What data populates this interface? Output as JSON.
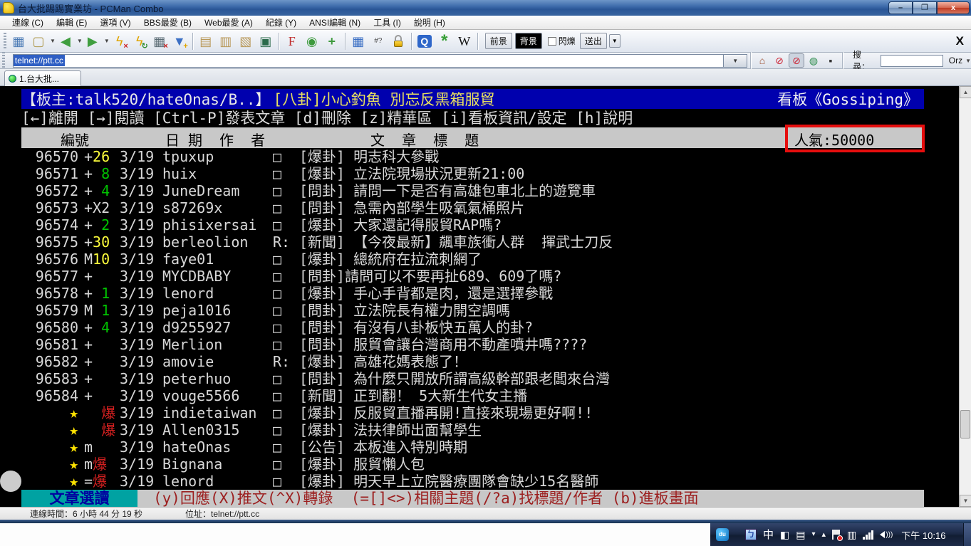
{
  "window": {
    "title": "台大批踢踢實業坊 - PCMan Combo",
    "minimize": "–",
    "restore": "❐",
    "close": "x"
  },
  "menu": {
    "items": [
      "連線 (C)",
      "編輯 (E)",
      "選項 (V)",
      "BBS最愛 (B)",
      "Web最愛 (A)",
      "紀錄 (Y)",
      "ANSI編輯 (N)",
      "工具 (I)",
      "說明 (H)"
    ]
  },
  "toolbar": {
    "buttons": [
      "session-icon",
      "new-tab-icon",
      "back-icon",
      "forward-icon",
      "disconnect-icon",
      "reconnect-icon",
      "close-session-icon",
      "add-bookmark-icon",
      "|",
      "copy-icon",
      "copy-ansi-icon",
      "paste-icon",
      "preview-icon",
      "|",
      "font-icon",
      "settings-gear-icon",
      "resize-window-icon",
      "|",
      "fullscreen-icon",
      "encoding-icon",
      "unlock-icon",
      "|",
      "quick-launch-icon",
      "services-icon",
      "wikipedia-icon"
    ],
    "ansi": {
      "foreground": "前景",
      "background": "背景",
      "blink": "閃爍",
      "send": "送出"
    },
    "close_glyph": "X"
  },
  "addressbar": {
    "url": "telnet://ptt.cc",
    "buttons": [
      "home-icon",
      "hide-sidebar-icon",
      "show-sidebar-icon",
      "globe-icon",
      "new-window-icon"
    ],
    "search_label": "搜尋：",
    "search_value": "",
    "search_engine": "Orz"
  },
  "tabs": [
    {
      "label": "1.台大批..."
    }
  ],
  "terminal": {
    "title_line": {
      "moderators": "【板主:talk520/hateOnas/B..】",
      "topic": "[八卦]小心釣魚 別忘反黑箱服貿",
      "board": "看板《Gossiping》"
    },
    "help_line": "[←]離開 [→]閱讀 [Ctrl-P]發表文章 [d]刪除 [z]精華區 [i]看板資訊/設定 [h]說明",
    "header": {
      "num": "編號",
      "date": "日 期",
      "author": "作  者",
      "title": "文  章  標  題",
      "popularity": "人氣:50000"
    },
    "rows": [
      {
        "num": "96570",
        "push": [
          {
            "t": "+",
            "c": "w"
          },
          {
            "t": "26",
            "c": "y"
          }
        ],
        "date": "3/19",
        "author": "tpuxup",
        "mark": "□",
        "title": "[爆卦] 明志科大參戰"
      },
      {
        "num": "96571",
        "push": [
          {
            "t": "+ ",
            "c": "w"
          },
          {
            "t": "8",
            "c": "g"
          }
        ],
        "date": "3/19",
        "author": "huix",
        "mark": "□",
        "title": "[爆卦] 立法院現場狀況更新21:00"
      },
      {
        "num": "96572",
        "push": [
          {
            "t": "+ ",
            "c": "w"
          },
          {
            "t": "4",
            "c": "g"
          }
        ],
        "date": "3/19",
        "author": "JuneDream",
        "mark": "□",
        "title": "[問卦] 請問一下是否有高雄包車北上的遊覽車"
      },
      {
        "num": "96573",
        "push": [
          {
            "t": "+X2",
            "c": "w"
          }
        ],
        "date": "3/19",
        "author": "s87269x",
        "mark": "□",
        "title": "[問卦] 急需內部學生吸氧氣桶照片"
      },
      {
        "num": "96574",
        "push": [
          {
            "t": "+ ",
            "c": "w"
          },
          {
            "t": "2",
            "c": "g"
          }
        ],
        "date": "3/19",
        "author": "phisixersai",
        "mark": "□",
        "title": "[爆卦] 大家還記得服貿RAP嗎?"
      },
      {
        "num": "96575",
        "push": [
          {
            "t": "+",
            "c": "w"
          },
          {
            "t": "30",
            "c": "y"
          }
        ],
        "date": "3/19",
        "author": "berleolion",
        "mark": "R:",
        "title": "[新聞] 【今夜最新】飆車族衝人群  揮武士刀反"
      },
      {
        "num": "96576",
        "push": [
          {
            "t": "M",
            "c": "w"
          },
          {
            "t": "10",
            "c": "y"
          }
        ],
        "date": "3/19",
        "author": "faye01",
        "mark": "□",
        "title": "[爆卦] 總統府在拉流刺網了"
      },
      {
        "num": "96577",
        "push": [
          {
            "t": "+",
            "c": "w"
          }
        ],
        "date": "3/19",
        "author": "MYCDBABY",
        "mark": "□",
        "title": "[問卦]請問可以不要再扯689、609了嗎?"
      },
      {
        "num": "96578",
        "push": [
          {
            "t": "+ ",
            "c": "w"
          },
          {
            "t": "1",
            "c": "g"
          }
        ],
        "date": "3/19",
        "author": "lenord",
        "mark": "□",
        "title": "[爆卦] 手心手背都是肉，還是選擇參戰"
      },
      {
        "num": "96579",
        "push": [
          {
            "t": "M ",
            "c": "w"
          },
          {
            "t": "1",
            "c": "g"
          }
        ],
        "date": "3/19",
        "author": "peja1016",
        "mark": "□",
        "title": "[問卦] 立法院長有權力開空調嗎"
      },
      {
        "num": "96580",
        "push": [
          {
            "t": "+ ",
            "c": "w"
          },
          {
            "t": "4",
            "c": "g"
          }
        ],
        "date": "3/19",
        "author": "d9255927",
        "mark": "□",
        "title": "[問卦] 有沒有八卦板快五萬人的卦?"
      },
      {
        "num": "96581",
        "push": [
          {
            "t": "+",
            "c": "w"
          }
        ],
        "date": "3/19",
        "author": "Merlion",
        "mark": "□",
        "title": "[問卦] 服貿會讓台灣商用不動產噴井嗎????"
      },
      {
        "num": "96582",
        "push": [
          {
            "t": "+",
            "c": "w"
          }
        ],
        "date": "3/19",
        "author": "amovie",
        "mark": "R:",
        "title": "[爆卦] 高雄花媽表態了！"
      },
      {
        "num": "96583",
        "push": [
          {
            "t": "+",
            "c": "w"
          }
        ],
        "date": "3/19",
        "author": "peterhuo",
        "mark": "□",
        "title": "[問卦] 為什麼只開放所謂高級幹部跟老闆來台灣"
      },
      {
        "num": "96584",
        "push": [
          {
            "t": "+",
            "c": "w"
          }
        ],
        "date": "3/19",
        "author": "vouge5566",
        "mark": "□",
        "title": "[新聞] 正到翻！ 5大新生代女主播"
      },
      {
        "star": true,
        "push": [
          {
            "t": "  ",
            "c": "w"
          },
          {
            "t": "爆",
            "c": "r"
          }
        ],
        "date": "3/19",
        "author": "indietaiwan",
        "mark": "□",
        "title": "[爆卦] 反服貿直播再開!直接來現場更好啊!!"
      },
      {
        "star": true,
        "push": [
          {
            "t": "  ",
            "c": "w"
          },
          {
            "t": "爆",
            "c": "r"
          }
        ],
        "date": "3/19",
        "author": "Allen0315",
        "mark": "□",
        "title": "[爆卦] 法扶律師出面幫學生"
      },
      {
        "star": true,
        "push": [
          {
            "t": "m",
            "c": "w"
          }
        ],
        "date": "3/19",
        "author": "hateOnas",
        "mark": "□",
        "title": "[公告] 本板進入特別時期"
      },
      {
        "star": true,
        "push": [
          {
            "t": "m",
            "c": "w"
          },
          {
            "t": "爆",
            "c": "r"
          }
        ],
        "date": "3/19",
        "author": "Bignana",
        "mark": "□",
        "title": "[爆卦] 服貿懶人包"
      },
      {
        "star": true,
        "cursor": true,
        "push": [
          {
            "t": "=",
            "c": "w"
          },
          {
            "t": "爆",
            "c": "r"
          }
        ],
        "date": "3/19",
        "author": "lenord",
        "mark": "□",
        "title": "[爆卦] 明天早上立院醫療團隊會缺少15名醫師"
      }
    ],
    "footer": {
      "mode": "文章選讀",
      "commands": "(y)回應(X)推文(^X)轉錄  (=[]<>)相關主題(/?a)找標題/作者 (b)進板畫面"
    }
  },
  "statusbar": {
    "connection_time": "連線時間：6 小時 44 分 19 秒",
    "address": "位址：telnet://ptt.cc"
  },
  "taskbar": {
    "tray": [
      "du-icon",
      "ime-language-icon",
      "ime-chinese-icon",
      "ime-shape-icon",
      "ime-pad-icon",
      "ime-menu-icon",
      "show-hidden-icons-icon",
      "action-center-icon",
      "clipboard-icon",
      "network-icon",
      "volume-icon"
    ],
    "ime_chinese": "中",
    "time": "下午 10:16"
  }
}
